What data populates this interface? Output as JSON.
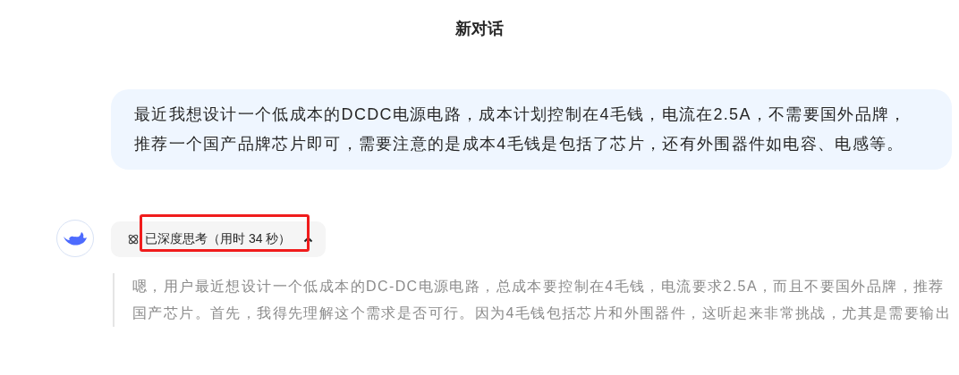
{
  "title": "新对话",
  "user_message": "最近我想设计一个低成本的DCDC电源电路，成本计划控制在4毛钱，电流在2.5A，不需要国外品牌，推荐一个国产品牌芯片即可，需要注意的是成本4毛钱是包括了芯片，还有外围器件如电容、电感等。",
  "thinking": {
    "label": "已深度思考（用时 34 秒）",
    "expanded": true,
    "highlighted": true
  },
  "thought": "嗯，用户最近想设计一个低成本的DC-DC电源电路，总成本要控制在4毛钱，电流要求2.5A，而且不要国外品牌，推荐国产芯片。首先，我得先理解这个需求是否可行。因为4毛钱包括芯片和外围器件，这听起来非常挑战，尤其是需要输出"
}
